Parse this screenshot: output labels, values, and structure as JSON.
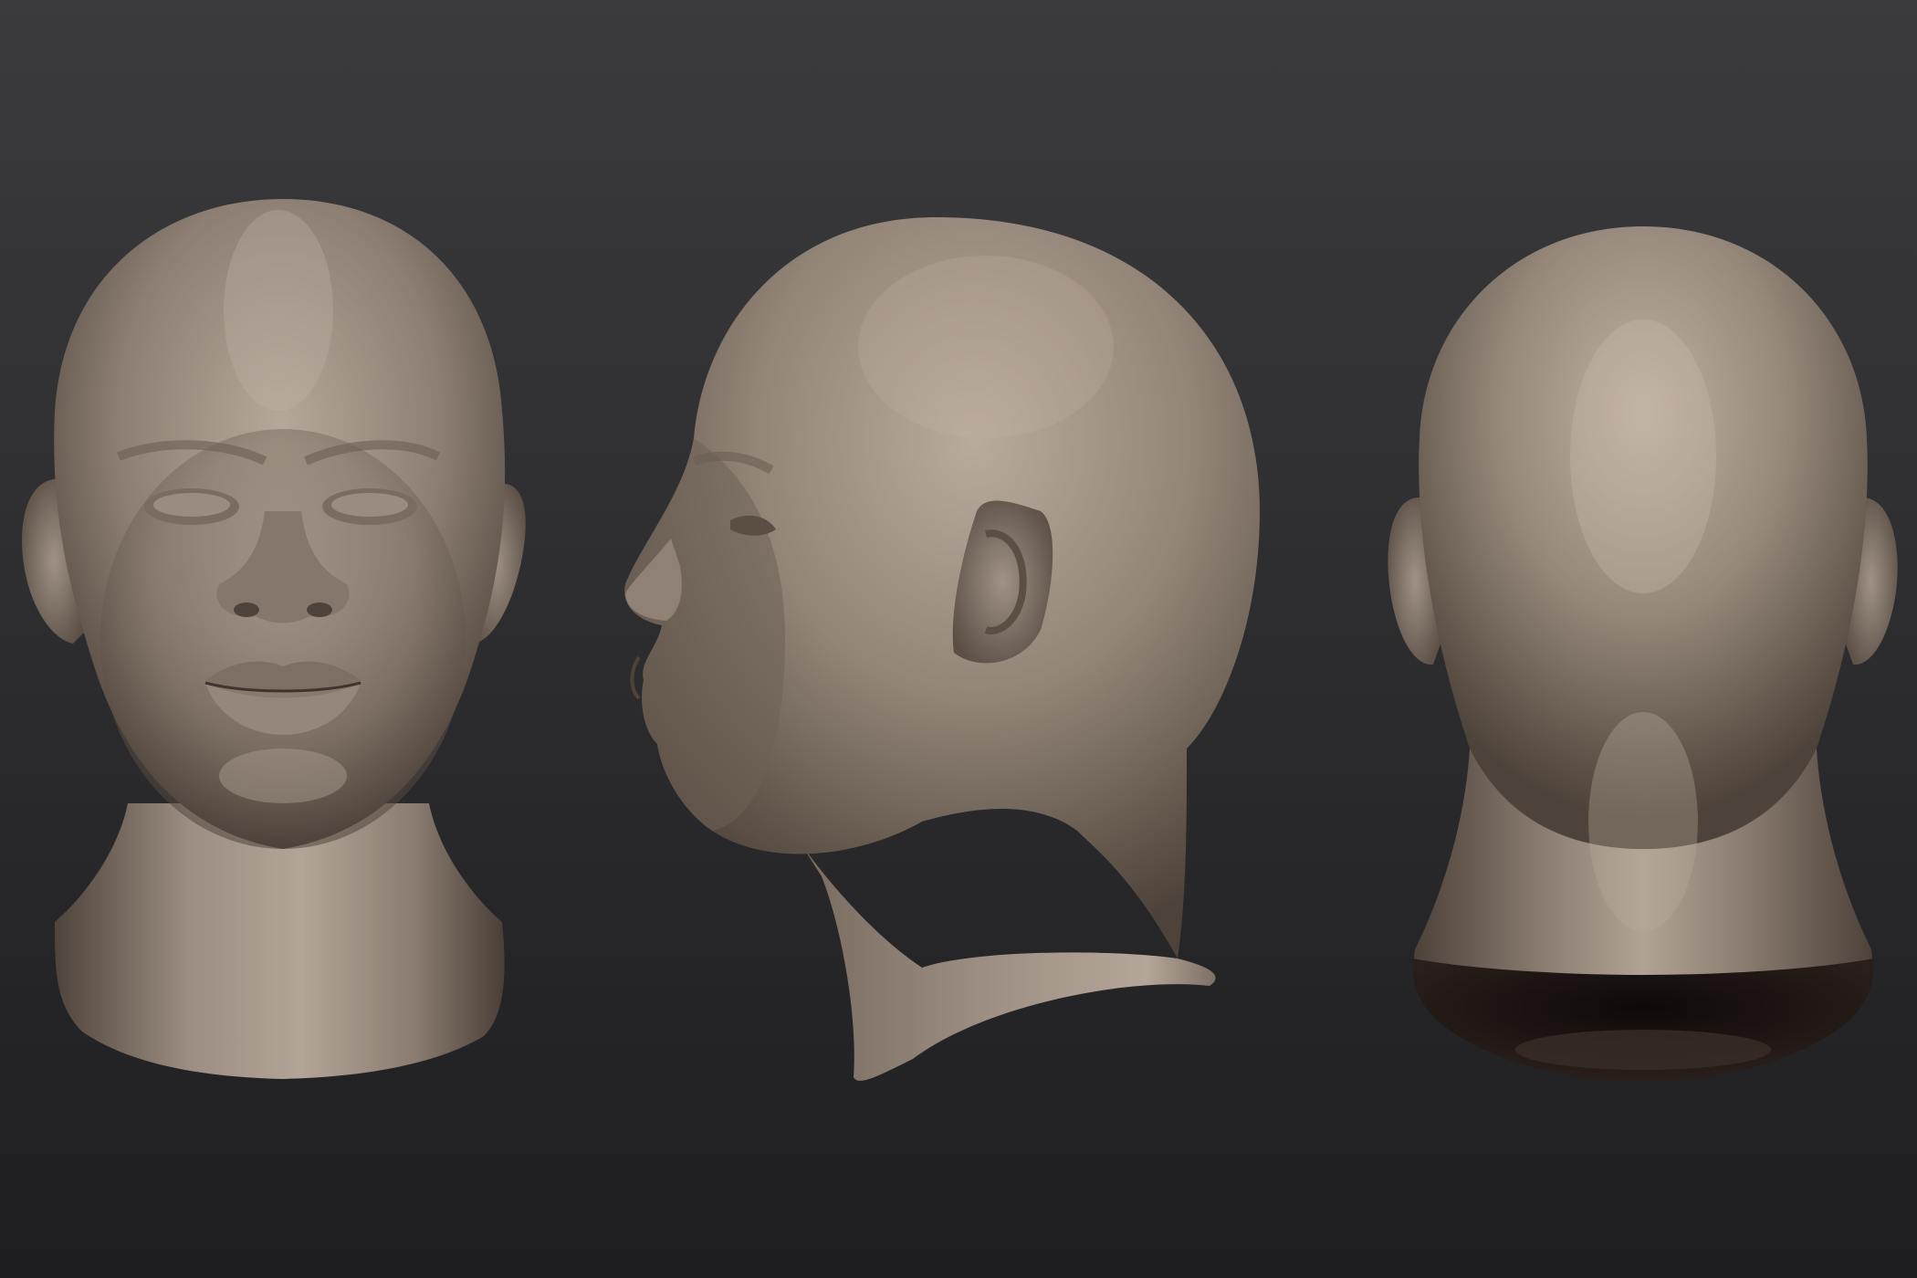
{
  "scene": {
    "background_top": "#3a3a3d",
    "background_bottom": "#1f1f21",
    "clay_light": "#b3a598",
    "clay_mid": "#8a7c70",
    "clay_dark": "#4a3f37",
    "cavity": "#140e0c",
    "views": [
      {
        "name": "front",
        "icon": "head-front-view"
      },
      {
        "name": "side",
        "icon": "head-profile-view"
      },
      {
        "name": "back",
        "icon": "head-back-view"
      }
    ]
  }
}
